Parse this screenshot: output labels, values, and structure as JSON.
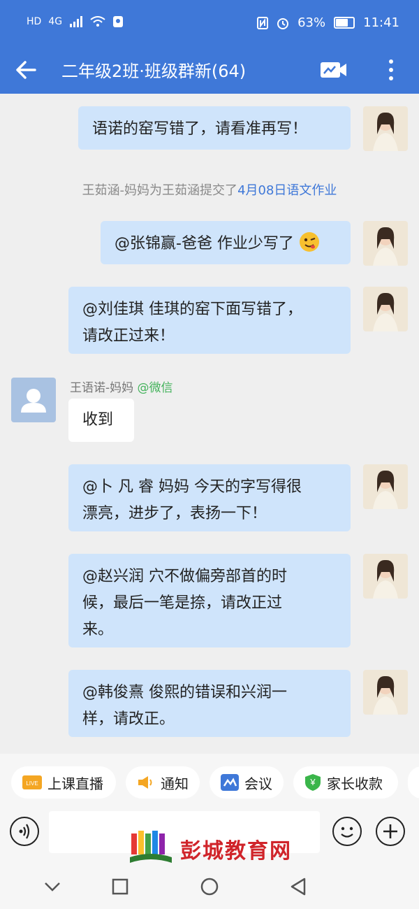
{
  "status_bar": {
    "left_icons": [
      "HD",
      "4G"
    ],
    "battery": "63%",
    "battery_level": 0.63,
    "time": "11:41"
  },
  "header": {
    "title": "二年级2班·班级群新(64)"
  },
  "messages": [
    {
      "text": "语诺的窑写错了，请看准再写！"
    },
    {
      "text": "@张锦赢-爸爸 作业少写了"
    },
    {
      "lines": [
        "@刘佳琪 佳琪的窑下面写错了，",
        "请改正过来！"
      ]
    },
    {
      "sender": "王语诺-妈妈",
      "source": "@微信",
      "text": "收到"
    },
    {
      "lines": [
        "@卜 凡 睿 妈妈  今天的字写得很",
        "漂亮，进步了，表扬一下！"
      ]
    },
    {
      "lines": [
        "@赵兴润 穴不做偏旁部首的时",
        "候，最后一笔是捺，请改正过",
        "来。"
      ]
    },
    {
      "lines": [
        "@韩俊熹 俊熙的错误和兴润一",
        "样，请改正。"
      ]
    }
  ],
  "system_notice": {
    "prefix": "王茹涵-妈妈为王茹涵提交了",
    "link": "4月08日语文作业"
  },
  "quick_actions": [
    {
      "label": "上课直播",
      "badge": "LIVE"
    },
    {
      "label": "通知"
    },
    {
      "label": "会议"
    },
    {
      "label": "家长收款",
      "badge": "¥"
    }
  ],
  "watermark": {
    "text": "彭城教育网"
  },
  "colors": {
    "primary": "#3f78d8",
    "bubble_right": "#cfe4fb",
    "wechat_green": "#44b35c",
    "watermark_red": "#d0242a"
  }
}
